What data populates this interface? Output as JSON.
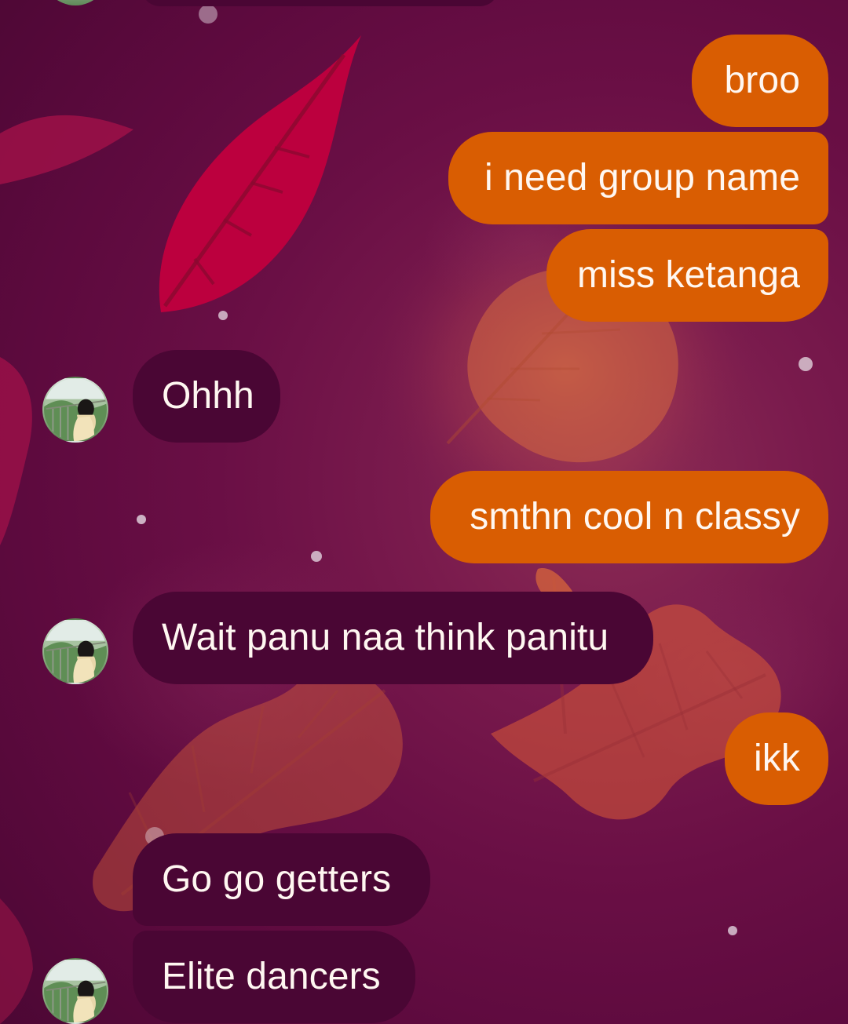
{
  "chat": {
    "messages": [
      {
        "side": "out",
        "text": "broo"
      },
      {
        "side": "out",
        "text": "i need group name"
      },
      {
        "side": "out",
        "text": "miss ketanga"
      },
      {
        "side": "in",
        "text": "Ohhh"
      },
      {
        "side": "out",
        "text": "smthn cool n classy"
      },
      {
        "side": "in",
        "text": "Wait panu naa think panitu"
      },
      {
        "side": "out",
        "text": "ikk"
      },
      {
        "side": "in",
        "text": "Go go getters"
      },
      {
        "side": "in",
        "text": "Elite dancers"
      }
    ]
  },
  "colors": {
    "background": "#6a0f45",
    "outgoing_bubble": "#d95d02",
    "incoming_bubble": "#4a0634",
    "text": "#fff7f1"
  },
  "icons": {
    "avatar": "profile-photo"
  }
}
